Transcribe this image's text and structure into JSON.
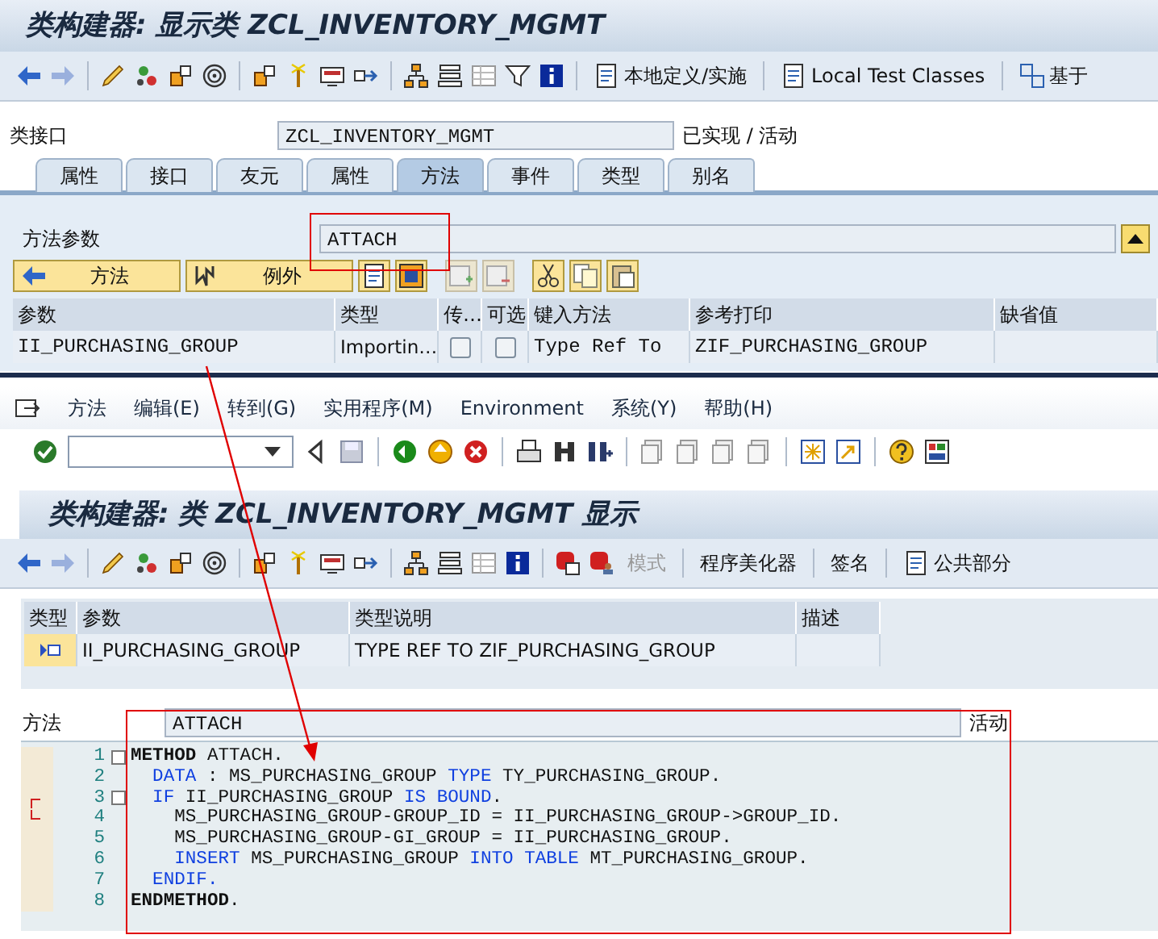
{
  "top_window": {
    "title": "类构建器: 显示类 ZCL_INVENTORY_MGMT",
    "toolbar_buttons": [
      {
        "label": "本地定义/实施"
      },
      {
        "label": "Local Test Classes"
      },
      {
        "label": "基于"
      }
    ],
    "class_field": {
      "label": "类接口",
      "value": "ZCL_INVENTORY_MGMT",
      "status": "已实现 / 活动"
    },
    "tabs": [
      {
        "label": "属性",
        "selected": false
      },
      {
        "label": "接口",
        "selected": false
      },
      {
        "label": "友元",
        "selected": false
      },
      {
        "label": "属性",
        "selected": false
      },
      {
        "label": "方法",
        "selected": true
      },
      {
        "label": "事件",
        "selected": false
      },
      {
        "label": "类型",
        "selected": false
      },
      {
        "label": "别名",
        "selected": false
      }
    ],
    "method_field": {
      "label": "方法参数",
      "value": "ATTACH"
    },
    "parameter_buttons": [
      {
        "label": "方法"
      },
      {
        "label": "例外"
      }
    ],
    "parameter_table": {
      "columns": [
        "参数",
        "类型",
        "传…",
        "可选",
        "键入方法",
        "参考打印",
        "缺省值"
      ],
      "rows": [
        {
          "parameter": "II_PURCHASING_GROUP",
          "type": "Importin…",
          "pass_by_value": false,
          "optional": false,
          "typing": "Type Ref To",
          "reference": "ZIF_PURCHASING_GROUP"
        }
      ]
    }
  },
  "bottom_window": {
    "menu": [
      "方法",
      "编辑(E)",
      "转到(G)",
      "实用程序(M)",
      "Environment",
      "系统(Y)",
      "帮助(H)"
    ],
    "title": "类构建器:  类 ZCL_INVENTORY_MGMT 显示",
    "toolbar_buttons": [
      {
        "label": "模式",
        "disabled": true,
        "kind": "text"
      },
      {
        "label": "程序美化器",
        "disabled": false,
        "kind": "text"
      },
      {
        "label": "签名",
        "disabled": false,
        "kind": "text"
      },
      {
        "label": "公共部分",
        "disabled": false,
        "kind": "icon_text"
      }
    ],
    "parameter_table": {
      "columns": [
        "类型",
        "参数",
        "类型说明",
        "描述"
      ],
      "rows": [
        {
          "parameter": "II_PURCHASING_GROUP",
          "type_description": "TYPE REF TO ZIF_PURCHASING_GROUP"
        }
      ]
    },
    "method_field": {
      "label": "方法",
      "value": "ATTACH",
      "status": "活动"
    },
    "code": {
      "lines": [
        {
          "number": "1",
          "foldable": true,
          "bracket_start": false,
          "bracket_end": false,
          "tokens": [
            {
              "text": "METHOD",
              "kind": "bold"
            },
            {
              "text": " ATTACH.",
              "kind": "plain"
            }
          ]
        },
        {
          "number": "2",
          "foldable": false,
          "bracket_start": false,
          "bracket_end": false,
          "tokens": [
            {
              "text": "  DATA",
              "kind": "keyword"
            },
            {
              "text": " : MS_PURCHASING_GROUP ",
              "kind": "plain"
            },
            {
              "text": "TYPE",
              "kind": "keyword"
            },
            {
              "text": " TY_PURCHASING_GROUP.",
              "kind": "plain"
            }
          ]
        },
        {
          "number": "3",
          "foldable": true,
          "bracket_start": true,
          "bracket_end": false,
          "tokens": [
            {
              "text": "  IF",
              "kind": "keyword"
            },
            {
              "text": " II_PURCHASING_GROUP ",
              "kind": "plain"
            },
            {
              "text": "IS BOUND",
              "kind": "keyword"
            },
            {
              "text": ".",
              "kind": "plain"
            }
          ]
        },
        {
          "number": "4",
          "foldable": false,
          "bracket_start": false,
          "bracket_end": true,
          "tokens": [
            {
              "text": "    MS_PURCHASING_GROUP-GROUP_ID = II_PURCHASING_GROUP->GROUP_ID.",
              "kind": "plain"
            }
          ]
        },
        {
          "number": "5",
          "foldable": false,
          "bracket_start": false,
          "bracket_end": false,
          "tokens": [
            {
              "text": "    MS_PURCHASING_GROUP-GI_GROUP = II_PURCHASING_GROUP.",
              "kind": "plain"
            }
          ]
        },
        {
          "number": "6",
          "foldable": false,
          "bracket_start": false,
          "bracket_end": false,
          "tokens": [
            {
              "text": "    INSERT",
              "kind": "keyword"
            },
            {
              "text": " MS_PURCHASING_GROUP ",
              "kind": "plain"
            },
            {
              "text": "INTO TABLE",
              "kind": "keyword"
            },
            {
              "text": " MT_PURCHASING_GROUP.",
              "kind": "plain"
            }
          ]
        },
        {
          "number": "7",
          "foldable": false,
          "bracket_start": false,
          "bracket_end": false,
          "tokens": [
            {
              "text": "  ENDIF.",
              "kind": "keyword"
            }
          ]
        },
        {
          "number": "8",
          "foldable": false,
          "bracket_start": false,
          "bracket_end": false,
          "tokens": [
            {
              "text": "ENDMETHOD",
              "kind": "bold"
            },
            {
              "text": ".",
              "kind": "plain"
            }
          ]
        }
      ]
    }
  }
}
